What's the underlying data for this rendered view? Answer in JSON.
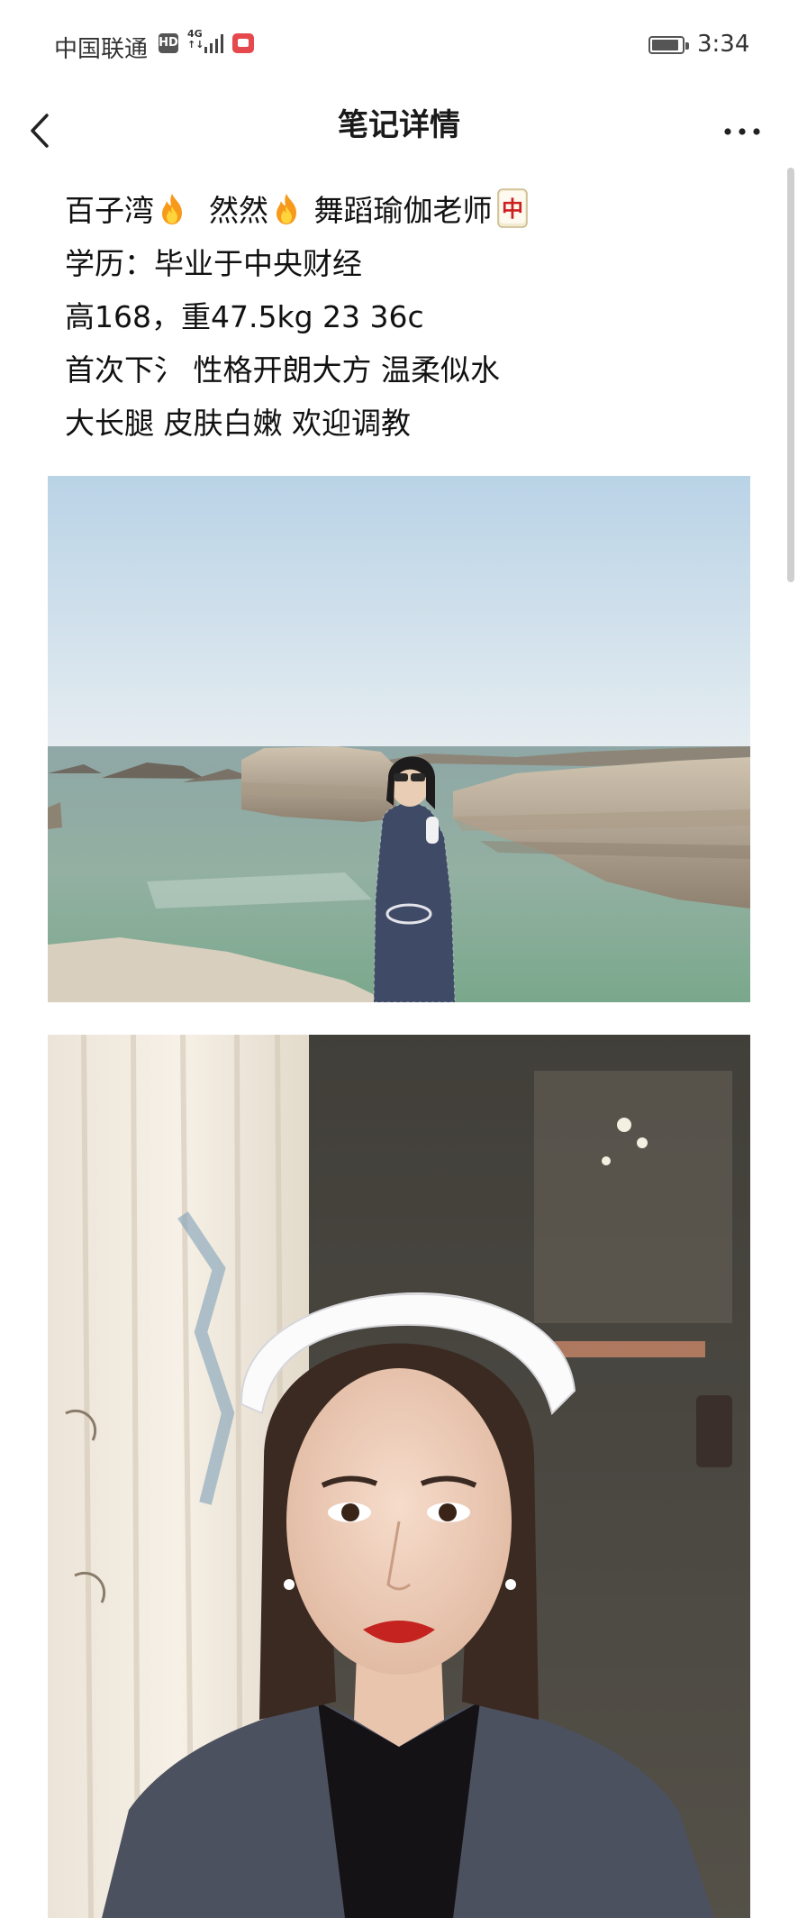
{
  "status_bar": {
    "carrier": "中国联通",
    "hd": "HD",
    "network_top": "4G",
    "network_bottom": "↑↓",
    "time": "3:34"
  },
  "nav": {
    "title": "笔记详情"
  },
  "note": {
    "line1_part1": "百子湾",
    "line1_part2": "然然",
    "line1_part3": "舞蹈瑜伽老师",
    "line2": "学历：毕业于中央财经",
    "line3": "高168，重47.5kg  23   36c",
    "line4": "首次下氵 性格开朗大方  温柔似水",
    "line5": "大长腿  皮肤白嫩  欢迎调教",
    "emoji_1": "fire-emoji",
    "emoji_2": "fire-emoji",
    "tile_char": "中"
  },
  "photos": [
    {
      "icon": "photo-seaside-woman"
    },
    {
      "icon": "photo-portrait-woman"
    }
  ],
  "colors": {
    "tile_red": "#cc1f1f",
    "accent": "#1a1a1a"
  }
}
